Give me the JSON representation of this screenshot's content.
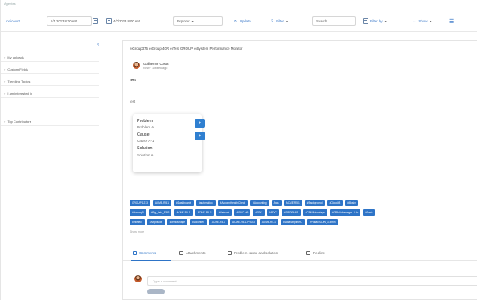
{
  "window": {
    "top_label": "Agentes"
  },
  "toolbar": {
    "back_label": "Indicount",
    "date_from": "1/1/2023 8:00 AM",
    "date_to": "4/7/2023 8:00 AM",
    "filter_select": "Explorer",
    "refresh_label": "Update",
    "filter_label": "Filter",
    "search_placeholder": "Search...",
    "filter_by_label": "Filter by",
    "show_label": "Show"
  },
  "sidebar": {
    "items": [
      {
        "label": "My uploads"
      },
      {
        "label": "Custom Fields"
      },
      {
        "label": "Trending Topics"
      },
      {
        "label": "I am interested in"
      },
      {
        "label": "Top Contributors"
      }
    ]
  },
  "post": {
    "title": "eiGroup376  eiGroup 40R eiTest GROUP eiSystem Performance Monitor",
    "author": "Guilherme Costa",
    "time": "New · 1 week ago",
    "body_bold": "test",
    "body_plain": "test",
    "card": {
      "problem_heading": "Problem",
      "problem_value": "Problem A",
      "cause_heading": "Cause",
      "cause_value": "Cause A-1",
      "solution_heading": "Solution",
      "solution_value": "Solution A",
      "button_plus": "+",
      "button_add": "+"
    },
    "tags_rows": [
      [
        "GROUP-1213",
        "ACME-R5-1",
        "#Dashboards",
        "#automation",
        "#AccountHealthCheck",
        "#Accounting",
        "Aws",
        "ACME-R5-1",
        "#Background",
        "#Cloud48",
        "#Busin"
      ],
      [
        "#Hadoop5",
        "#Big_data_ERP",
        "ACME-R5-1",
        "ACME-R5-1",
        "#Network",
        "ARDC-H6",
        "#EPC",
        "ARDC",
        "#IPROPLAB",
        "#CRMAdvantage",
        "#CRMAdvantage - Lab",
        "#Dash"
      ],
      [
        "#Intellect",
        "#Amplitude",
        "#JentManage",
        "#Locontex",
        "ACME-R5-1",
        "ACME-R5-1-PRD-3",
        "ACME-R5-1",
        "#DataSimplify/IO",
        "#Portal4/LDev_3.4.mm"
      ]
    ],
    "show_more": "Show more",
    "tabs": [
      {
        "label": "Comments"
      },
      {
        "label": "Attachments"
      },
      {
        "label": "Problem cause and solution"
      },
      {
        "label": "Redline"
      }
    ],
    "comment_placeholder": "Type a comment"
  },
  "colors": {
    "accent": "#2e74c7",
    "tag_bg": "#2e74c7",
    "card_button": "#2f7fd0"
  }
}
